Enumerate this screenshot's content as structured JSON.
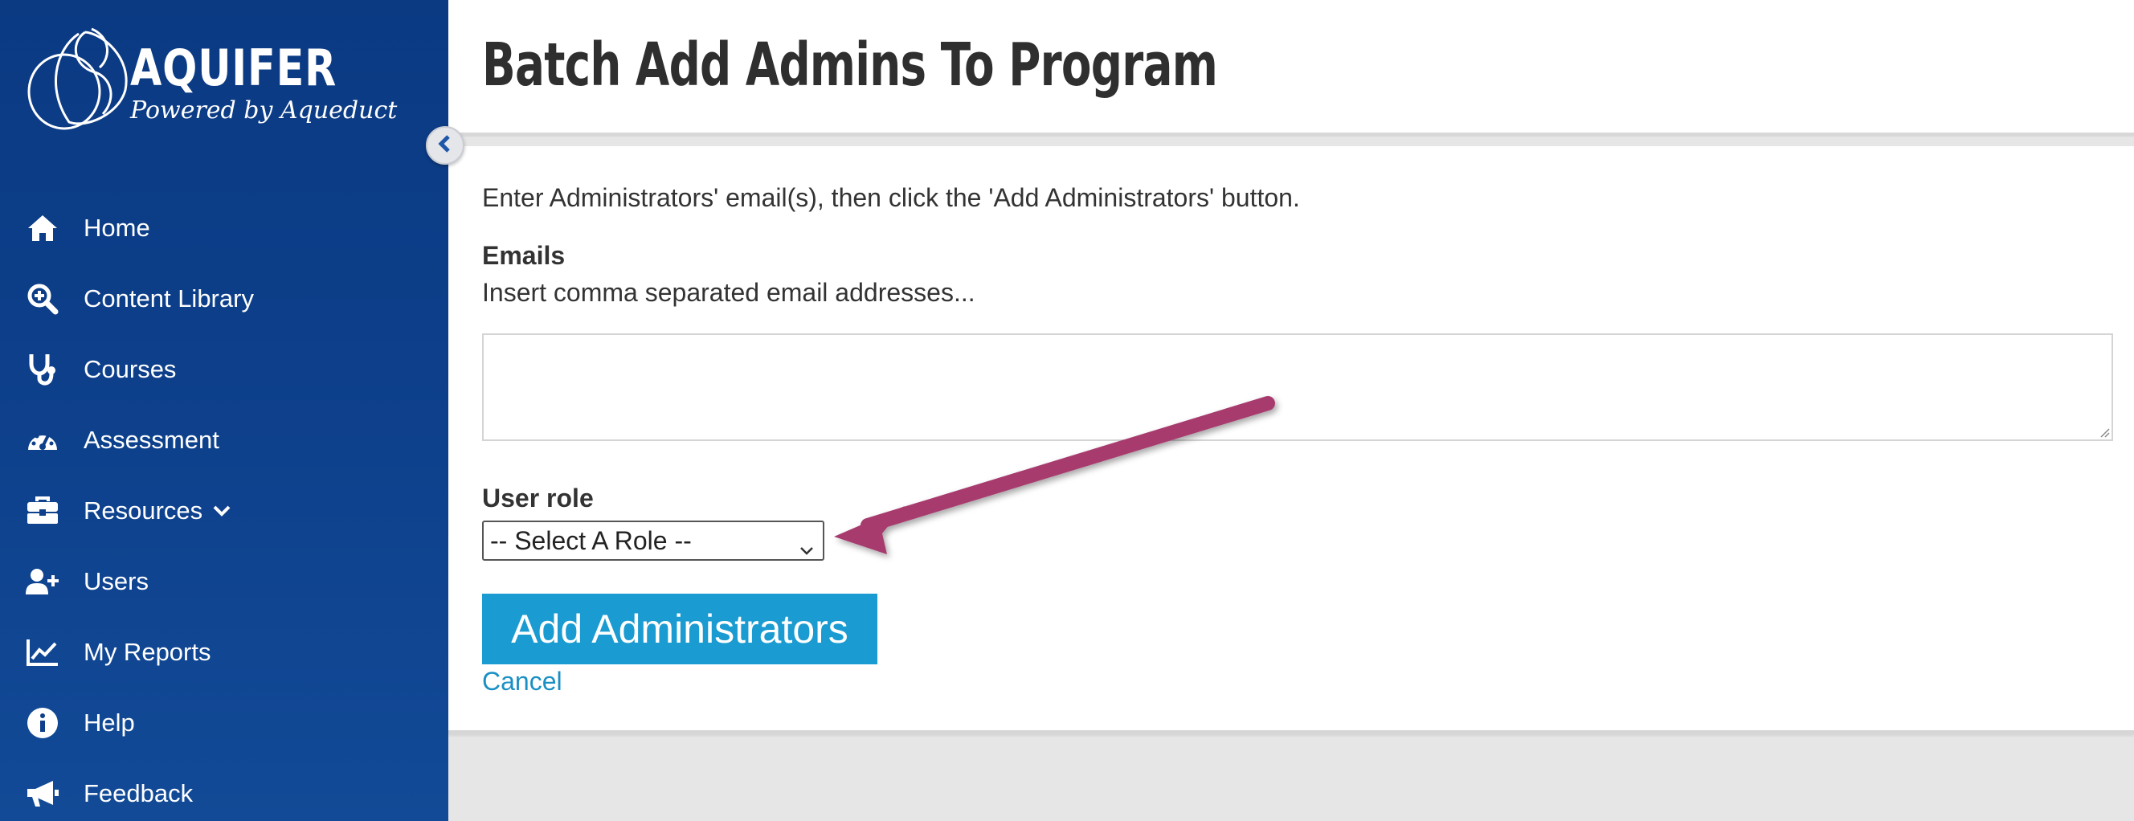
{
  "brand": {
    "title": "AQUIFER",
    "subtitle": "Powered by Aqueduct"
  },
  "sidebar": {
    "collapse_icon": "chevron-left-icon",
    "items": [
      {
        "label": "Home",
        "icon": "home-icon"
      },
      {
        "label": "Content Library",
        "icon": "search-plus-icon"
      },
      {
        "label": "Courses",
        "icon": "stethoscope-icon"
      },
      {
        "label": "Assessment",
        "icon": "gauge-icon"
      },
      {
        "label": "Resources",
        "icon": "briefcase-icon",
        "has_dropdown": true
      },
      {
        "label": "Users",
        "icon": "user-plus-icon"
      },
      {
        "label": "My Reports",
        "icon": "chart-line-icon"
      },
      {
        "label": "Help",
        "icon": "info-circle-icon"
      },
      {
        "label": "Feedback",
        "icon": "megaphone-icon"
      }
    ]
  },
  "page": {
    "title": "Batch Add Admins To Program"
  },
  "form": {
    "instructions": "Enter Administrators' email(s), then click the 'Add Administrators' button.",
    "emails_label": "Emails",
    "emails_help": "Insert comma separated email addresses...",
    "emails_value": "",
    "role_label": "User role",
    "role_selected": "-- Select A Role --",
    "submit_label": "Add Administrators",
    "cancel_label": "Cancel"
  },
  "colors": {
    "sidebar_bg": "#0d3f8a",
    "primary_button": "#1a9bd1",
    "link": "#1a8fc4",
    "annotation_arrow": "#a83a6e"
  }
}
